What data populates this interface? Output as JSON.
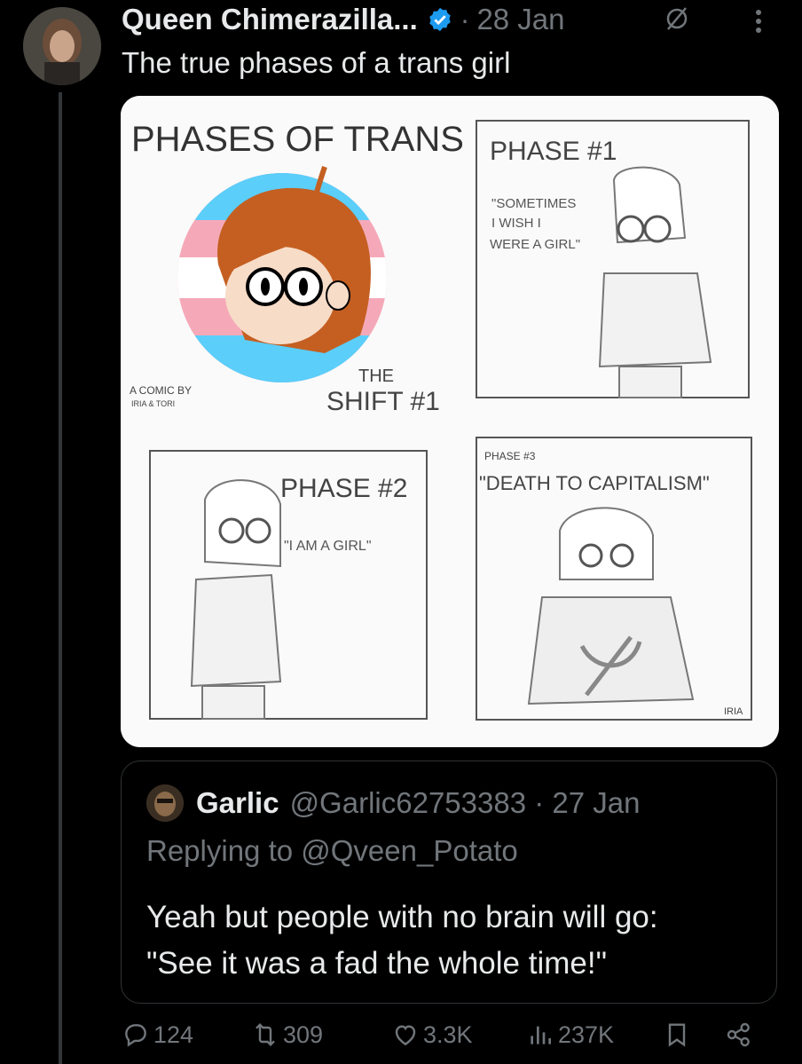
{
  "tweet": {
    "author_name": "Queen Chimerazilla...",
    "separator": "·",
    "date": "28 Jan",
    "text": "The true phases of a trans girl"
  },
  "comic": {
    "title": "PHASES OF TRANS",
    "credit_line1": "A COMIC BY",
    "credit_line2": "IRIA & TORI",
    "shift_line1": "THE",
    "shift_line2": "SHIFT #1",
    "phase1_title": "PHASE #1",
    "phase1_quote_line1": "\"SOMETIMES",
    "phase1_quote_line2": "I WISH I",
    "phase1_quote_line3": "WERE A GIRL\"",
    "phase2_title": "PHASE #2",
    "phase2_quote": "\"I AM A GIRL\"",
    "phase3_title": "PHASE #3",
    "phase3_quote": "\"DEATH TO CAPITALISM\"",
    "signature": "IRIA"
  },
  "quote": {
    "name": "Garlic",
    "handle_date": "@Garlic62753383 · 27 Jan",
    "replying_to": "Replying to @Qveen_Potato",
    "body_line1": "Yeah but people with no brain will go:",
    "body_line2": "\"See it was a fad the whole time!\""
  },
  "actions": {
    "replies": "124",
    "reposts": "309",
    "likes": "3.3K",
    "views": "237K"
  },
  "colors": {
    "background": "#000000",
    "text": "#e7e9ea",
    "muted": "#71767b",
    "verified": "#1d9bf0",
    "trans_blue": "#5bcefa",
    "trans_pink": "#f5a9b8"
  },
  "icons": [
    "verified-badge-icon",
    "mute-icon",
    "more-icon",
    "reply-icon",
    "repost-icon",
    "like-icon",
    "views-icon",
    "bookmark-icon",
    "share-icon"
  ]
}
